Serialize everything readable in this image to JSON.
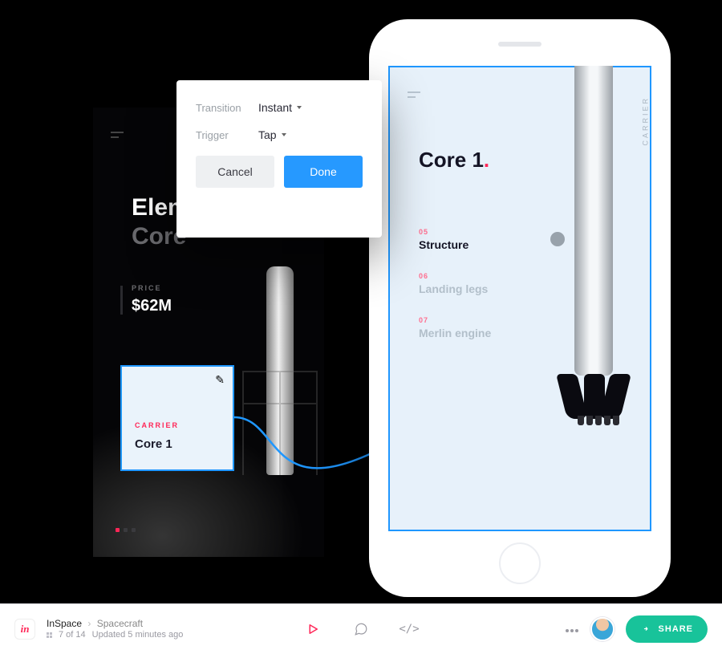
{
  "darkScreen": {
    "title1": "Eleme",
    "title2": "Core",
    "priceLabel": "PRICE",
    "priceValue": "$62M"
  },
  "hotspot": {
    "category": "CARRIER",
    "label": "Core 1",
    "editGlyph": "✎"
  },
  "popover": {
    "transitionKey": "Transition",
    "transitionValue": "Instant",
    "triggerKey": "Trigger",
    "triggerValue": "Tap",
    "cancel": "Cancel",
    "done": "Done"
  },
  "lightScreen": {
    "verticalLabel": "CARRIER",
    "title": "Core 1",
    "items": [
      {
        "num": "05",
        "label": "Structure",
        "active": true
      },
      {
        "num": "06",
        "label": "Landing legs",
        "active": false
      },
      {
        "num": "07",
        "label": "Merlin engine",
        "active": false
      }
    ]
  },
  "appbar": {
    "logo": "in",
    "project": "InSpace",
    "section": "Spacecraft",
    "position": "7 of 14",
    "updated": "Updated 5 minutes ago",
    "share": "SHARE"
  }
}
